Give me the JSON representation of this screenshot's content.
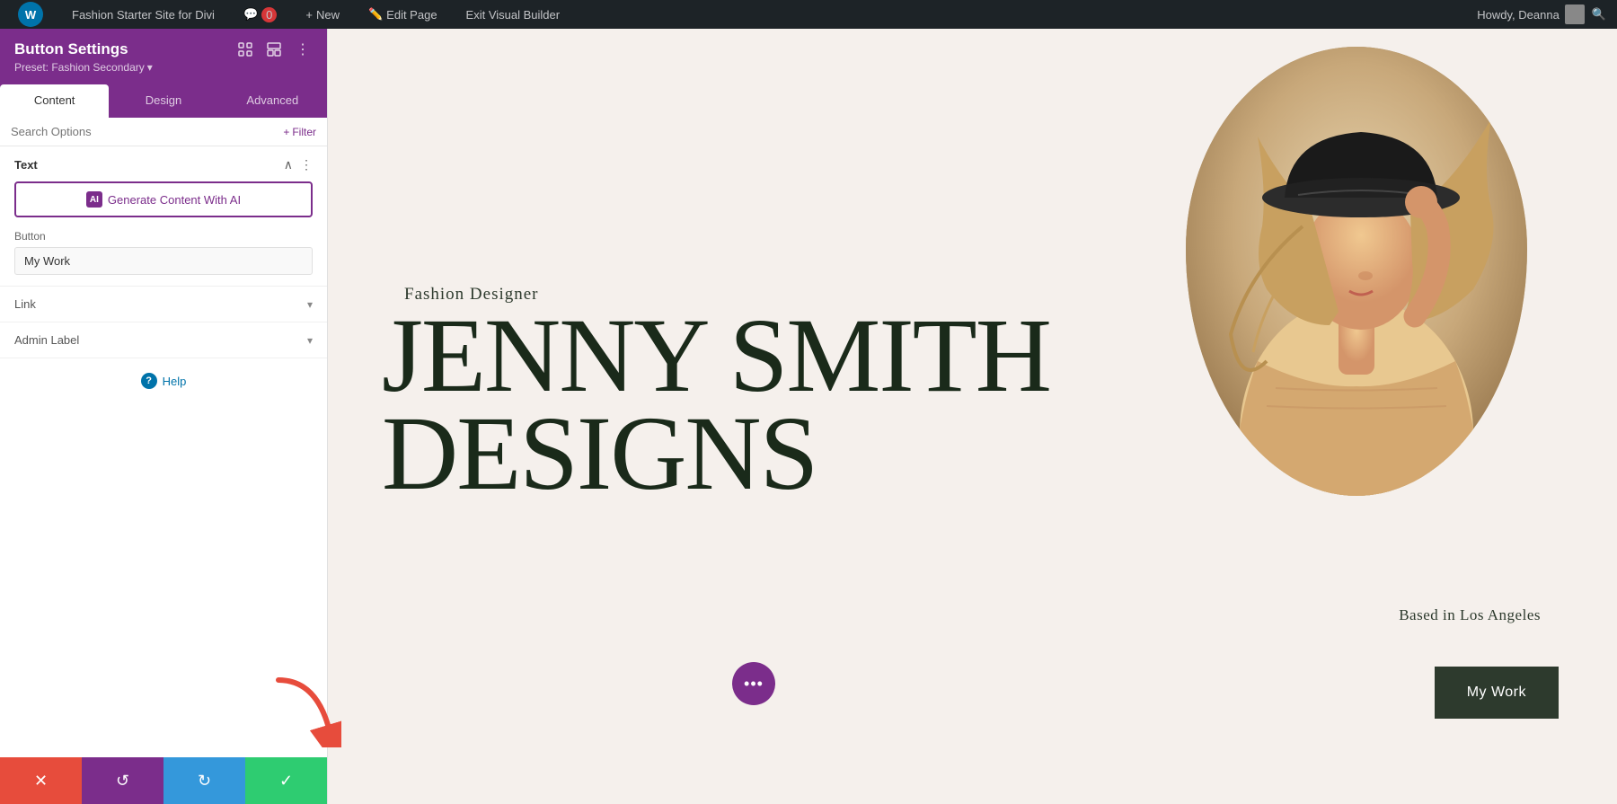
{
  "wp_admin_bar": {
    "site_name": "Fashion Starter Site for Divi",
    "comments_count": "0",
    "new_label": "New",
    "edit_page_label": "Edit Page",
    "exit_builder_label": "Exit Visual Builder",
    "howdy_text": "Howdy, Deanna"
  },
  "panel": {
    "title": "Button Settings",
    "preset_label": "Preset: Fashion Secondary",
    "tabs": [
      {
        "label": "Content",
        "active": true
      },
      {
        "label": "Design",
        "active": false
      },
      {
        "label": "Advanced",
        "active": false
      }
    ],
    "search_placeholder": "Search Options",
    "filter_label": "Filter",
    "text_section": {
      "title": "Text",
      "generate_ai_label": "Generate Content With AI",
      "button_field_label": "Button",
      "button_value": "My Work"
    },
    "link_section": {
      "title": "Link"
    },
    "admin_label_section": {
      "title": "Admin Label"
    },
    "help_label": "Help",
    "actions": {
      "close_title": "Close",
      "undo_title": "Undo",
      "redo_title": "Redo",
      "save_title": "Save"
    }
  },
  "canvas": {
    "subtitle": "Fashion Designer",
    "name_line1": "JENNY SMITH",
    "name_line2": "DESIGNS",
    "location": "Based in Los Angeles",
    "mywork_btn": "My Work"
  },
  "icons": {
    "ai_icon": "AI",
    "chevron_down": "▾",
    "dots_vertical": "⋮",
    "search_icon": "🔍",
    "filter_plus": "+",
    "close_x": "✕",
    "undo_icon": "↺",
    "redo_icon": "↻",
    "check_icon": "✓",
    "question_mark": "?",
    "three_dots": "•••",
    "wp_icon": "W"
  },
  "colors": {
    "purple": "#7b2d8b",
    "dark_green": "#1a2a1a",
    "red": "#e74c3c",
    "blue": "#3498db",
    "green": "#2ecc71",
    "cream": "#f5f0ec"
  }
}
